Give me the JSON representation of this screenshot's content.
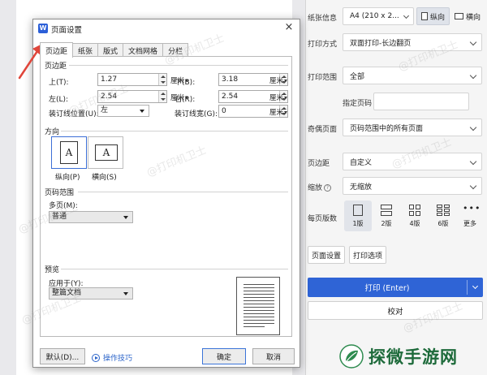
{
  "dialog": {
    "title": "页面设置",
    "close_glyph": "×",
    "app_icon_letter": "W",
    "tabs": [
      {
        "label": "页边距",
        "active": true
      },
      {
        "label": "纸张",
        "active": false
      },
      {
        "label": "版式",
        "active": false
      },
      {
        "label": "文档网格",
        "active": false
      },
      {
        "label": "分栏",
        "active": false
      }
    ],
    "margins": {
      "section": "页边距",
      "top_label": "上(T):",
      "top_value": "1.27",
      "bottom_label": "下(B):",
      "bottom_value": "3.18",
      "left_label": "左(L):",
      "left_value": "2.54",
      "right_label": "右(R):",
      "right_value": "2.54",
      "gutter_pos_label": "装订线位置(U):",
      "gutter_pos_value": "左",
      "gutter_label": "装订线宽(G):",
      "gutter_value": "0",
      "unit": "厘米"
    },
    "orientation": {
      "section": "方向",
      "portrait_label": "纵向(P)",
      "landscape_label": "横向(S)",
      "glyph": "A",
      "selected": "portrait"
    },
    "pages": {
      "section": "页码范围",
      "multi_label": "多页(M):",
      "multi_value": "普通"
    },
    "preview": {
      "section": "预览",
      "apply_label": "应用于(Y):",
      "apply_value": "整篇文档"
    },
    "buttons": {
      "default": "默认(D)...",
      "tips": "操作技巧",
      "ok": "确定",
      "cancel": "取消"
    }
  },
  "print_panel": {
    "paper_label": "纸张信息",
    "paper_value": "A4 (210 x 2...",
    "portrait": "纵向",
    "landscape": "横向",
    "method_label": "打印方式",
    "method_value": "双面打印-长边翻页",
    "range_label": "打印范围",
    "range_value": "全部",
    "pages_label": "指定页码",
    "odd_even_label": "奇偶页面",
    "odd_even_value": "页码范围中的所有页面",
    "margin_label": "页边距",
    "margin_value": "自定义",
    "zoom_label": "缩放",
    "zoom_value": "无缩放",
    "pps_label": "每页版数",
    "pps_options": [
      "1版",
      "2版",
      "4版",
      "6版",
      "更多"
    ],
    "page_setup_btn": "页面设置",
    "print_options_btn": "打印选项",
    "print_btn": "打印 (Enter)",
    "proof_btn": "校对"
  },
  "watermark_text": "@打印机卫士",
  "brand": {
    "name": "探微手游网",
    "color": "#1d6a3a"
  },
  "colors": {
    "accent": "#2f64d6",
    "annotation_arrow": "#e0453a"
  }
}
